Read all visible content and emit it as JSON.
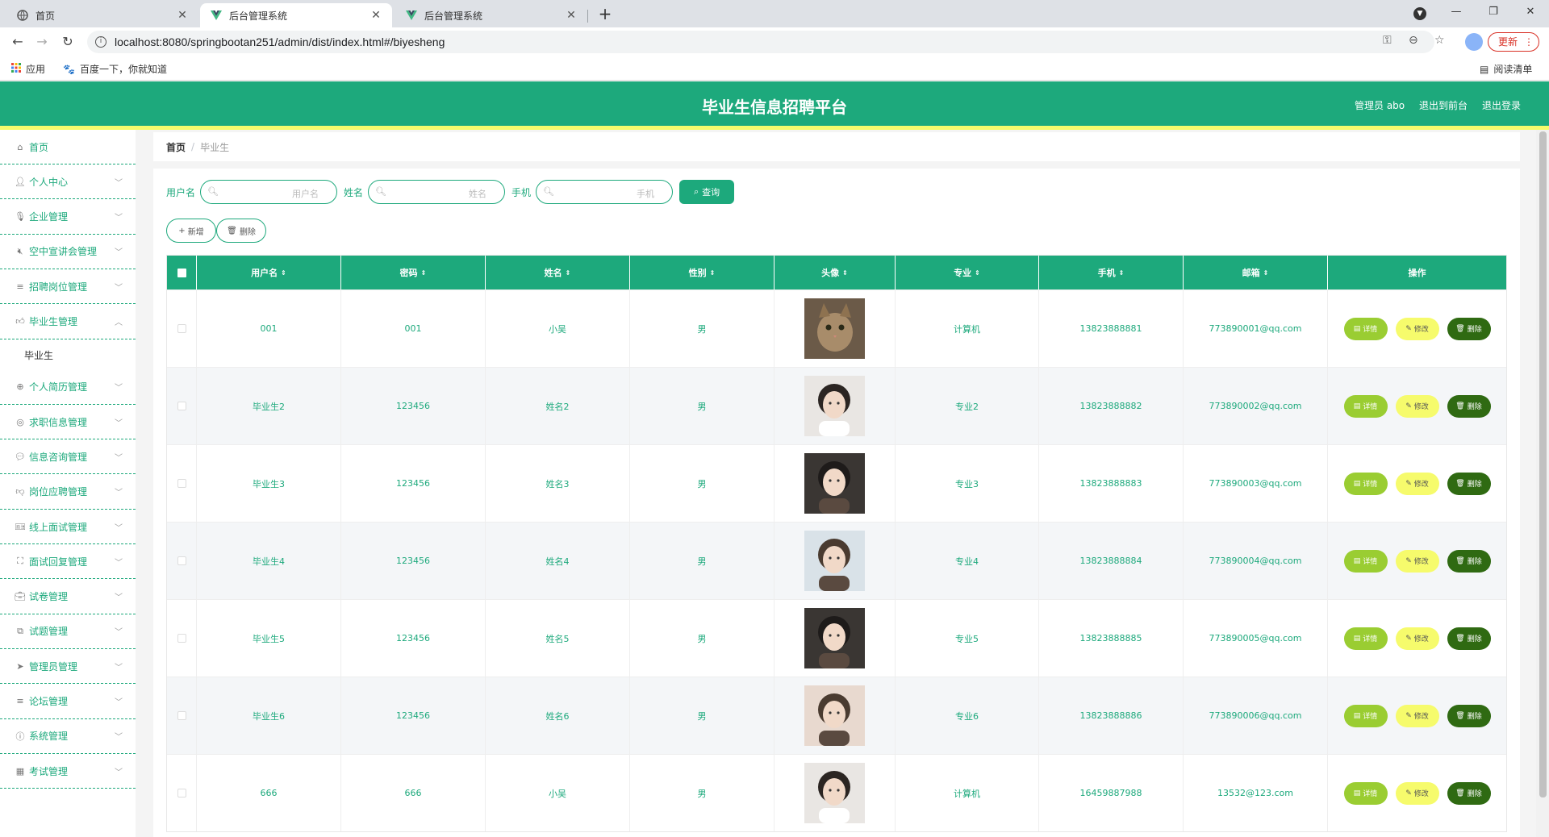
{
  "browser": {
    "tabs": [
      {
        "title": "首页",
        "icon": "globe-icon"
      },
      {
        "title": "后台管理系统",
        "icon": "vue-icon"
      },
      {
        "title": "后台管理系统",
        "icon": "vue-icon"
      }
    ],
    "url": "localhost:8080/springbootan251/admin/dist/index.html#/biyesheng",
    "update_label": "更新",
    "bookmarks": [
      {
        "label": "应用",
        "icon": "apps-grid-icon"
      },
      {
        "label": "百度一下，你就知道",
        "icon": "baidu-paw-icon"
      }
    ],
    "reading_list_label": "阅读清单"
  },
  "header": {
    "title": "毕业生信息招聘平台",
    "admin_label": "管理员 abo",
    "to_front_label": "退出到前台",
    "logout_label": "退出登录"
  },
  "sidebar": {
    "items": [
      {
        "label": "首页",
        "icon": "home-icon",
        "has_arrow": false
      },
      {
        "label": "个人中心",
        "icon": "user-icon",
        "has_arrow": true
      },
      {
        "label": "企业管理",
        "icon": "mic-icon",
        "has_arrow": true
      },
      {
        "label": "空中宣讲会管理",
        "icon": "mute-icon",
        "has_arrow": true
      },
      {
        "label": "招聘岗位管理",
        "icon": "list-icon",
        "has_arrow": true
      },
      {
        "label": "毕业生管理",
        "icon": "thumb-icon",
        "has_arrow": true,
        "expanded": true
      },
      {
        "label": "个人简历管理",
        "icon": "compass-icon",
        "has_arrow": true
      },
      {
        "label": "求职信息管理",
        "icon": "target-icon",
        "has_arrow": true
      },
      {
        "label": "信息咨询管理",
        "icon": "chat-icon",
        "has_arrow": true
      },
      {
        "label": "岗位应聘管理",
        "icon": "thumb-down-icon",
        "has_arrow": true
      },
      {
        "label": "线上面试管理",
        "icon": "ticket-icon",
        "has_arrow": true
      },
      {
        "label": "面试回复管理",
        "icon": "fullscreen-icon",
        "has_arrow": true
      },
      {
        "label": "试卷管理",
        "icon": "briefcase-icon",
        "has_arrow": true
      },
      {
        "label": "试题管理",
        "icon": "crop-icon",
        "has_arrow": true
      },
      {
        "label": "管理员管理",
        "icon": "send-icon",
        "has_arrow": true
      },
      {
        "label": "论坛管理",
        "icon": "menu-icon",
        "has_arrow": true
      },
      {
        "label": "系统管理",
        "icon": "info-icon",
        "has_arrow": true
      },
      {
        "label": "考试管理",
        "icon": "grid-icon",
        "has_arrow": true
      }
    ],
    "submenu": {
      "label": "毕业生"
    }
  },
  "breadcrumb": {
    "home": "首页",
    "current": "毕业生"
  },
  "search": {
    "username_label": "用户名",
    "username_placeholder": "用户名",
    "name_label": "姓名",
    "name_placeholder": "姓名",
    "phone_label": "手机",
    "phone_placeholder": "手机",
    "query_label": "查询"
  },
  "actions": {
    "add_label": "新增",
    "delete_label": "删除"
  },
  "table": {
    "columns": [
      "用户名",
      "密码",
      "姓名",
      "性别",
      "头像",
      "专业",
      "手机",
      "邮箱",
      "操作"
    ],
    "op_labels": {
      "detail": "详情",
      "edit": "修改",
      "delete": "删除"
    },
    "rows": [
      {
        "username": "001",
        "password": "001",
        "name": "小吴",
        "gender": "男",
        "major": "计算机",
        "phone": "13823888881",
        "email": "773890001@qq.com",
        "avatar": "cat"
      },
      {
        "username": "毕业生2",
        "password": "123456",
        "name": "姓名2",
        "gender": "男",
        "major": "专业2",
        "phone": "13823888882",
        "email": "773890002@qq.com",
        "avatar": "boy"
      },
      {
        "username": "毕业生3",
        "password": "123456",
        "name": "姓名3",
        "gender": "男",
        "major": "专业3",
        "phone": "13823888883",
        "email": "773890003@qq.com",
        "avatar": "girl-dark"
      },
      {
        "username": "毕业生4",
        "password": "123456",
        "name": "姓名4",
        "gender": "男",
        "major": "专业4",
        "phone": "13823888884",
        "email": "773890004@qq.com",
        "avatar": "girl-sea"
      },
      {
        "username": "毕业生5",
        "password": "123456",
        "name": "姓名5",
        "gender": "男",
        "major": "专业5",
        "phone": "13823888885",
        "email": "773890005@qq.com",
        "avatar": "girl-dark"
      },
      {
        "username": "毕业生6",
        "password": "123456",
        "name": "姓名6",
        "gender": "男",
        "major": "专业6",
        "phone": "13823888886",
        "email": "773890006@qq.com",
        "avatar": "girl-light"
      },
      {
        "username": "666",
        "password": "666",
        "name": "小吴",
        "gender": "男",
        "major": "计算机",
        "phone": "16459887988",
        "email": "13532@123.com",
        "avatar": "boy"
      }
    ]
  },
  "colors": {
    "primary": "#1da97c",
    "accent_yellow": "#f6fb6c",
    "detail_btn": "#9acd32",
    "delete_btn": "#2f6a12"
  }
}
